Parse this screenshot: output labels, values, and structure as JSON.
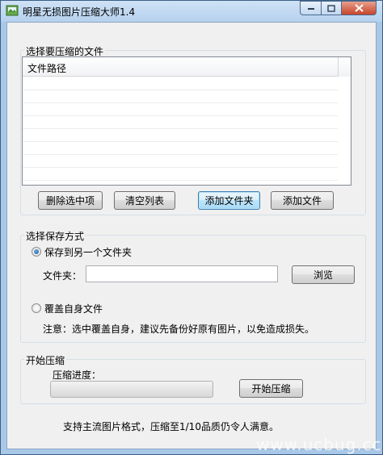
{
  "window": {
    "title": "明星无损图片压缩大师1.4"
  },
  "file_group": {
    "label": "选择要压缩的文件",
    "column_header": "文件路径",
    "rows": [],
    "buttons": {
      "delete_selected": "删除选中项",
      "clear_list": "清空列表",
      "add_folder": "添加文件夹",
      "add_file": "添加文件"
    }
  },
  "save_group": {
    "label": "选择保存方式",
    "option_folder": "保存到另一个文件夹",
    "option_folder_selected": true,
    "folder_label": "文件夹：",
    "folder_value": "",
    "browse": "浏览",
    "option_overwrite": "覆盖自身文件",
    "option_overwrite_selected": false,
    "note": "注意：选中覆盖自身，建议先备份好原有图片，以免造成损失。"
  },
  "compress_group": {
    "label": "开始压缩",
    "progress_label": "压缩进度：",
    "progress": 0,
    "start": "开始压缩"
  },
  "footer": "支持主流图片格式，压缩至1/10品质仍令人满意。",
  "watermark": "www.ucbug.cc",
  "colors": {
    "title_bar": "#b6d1ee",
    "close_button": "#c7432a",
    "client_background": "#f0f0f0"
  }
}
